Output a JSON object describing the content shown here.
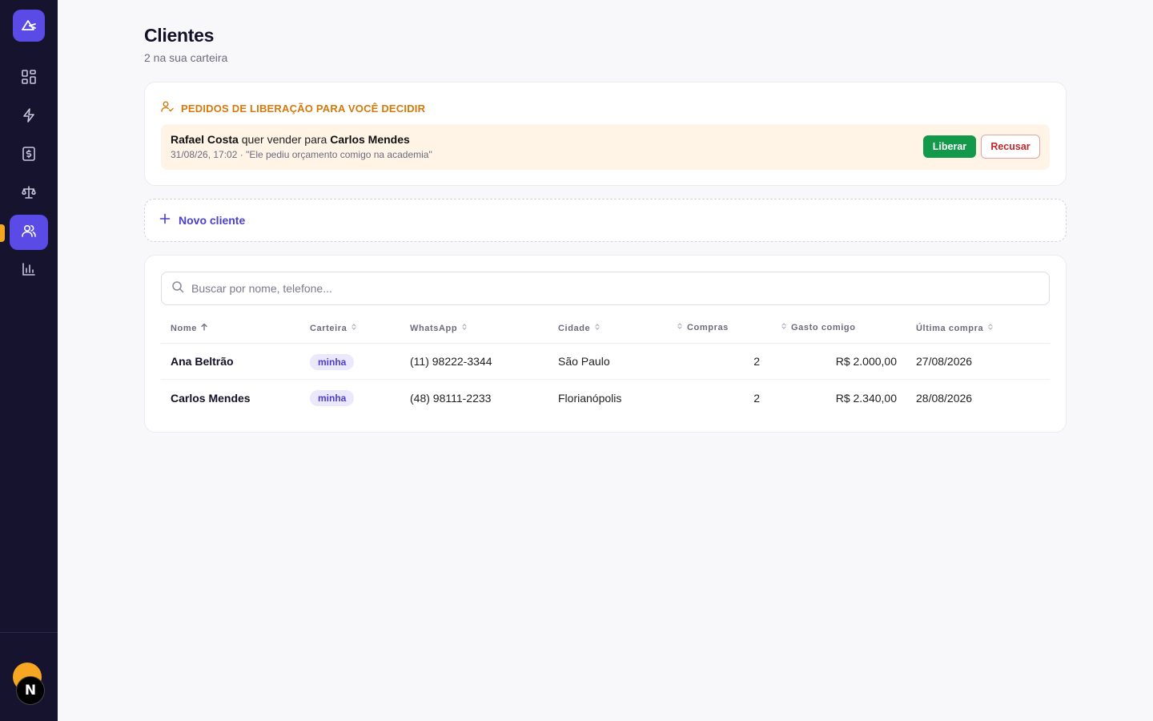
{
  "sidebar": {
    "logo": "logo-icon",
    "items": [
      {
        "icon": "dashboard-icon",
        "active": false
      },
      {
        "icon": "lightning-icon",
        "active": false
      },
      {
        "icon": "invoice-icon",
        "active": false
      },
      {
        "icon": "scale-icon",
        "active": false
      },
      {
        "icon": "users-icon",
        "active": true
      },
      {
        "icon": "bar-chart-icon",
        "active": false
      }
    ],
    "next_badge": "N"
  },
  "page": {
    "title": "Clientes",
    "subtitle": "2 na sua carteira"
  },
  "requests": {
    "title": "PEDIDOS DE LIBERAÇÃO PARA VOCÊ DECIDIR",
    "items": [
      {
        "requester": "Rafael Costa",
        "verb": " quer vender para ",
        "client": "Carlos Mendes",
        "meta": "31/08/26, 17:02 · \"Ele pediu orçamento comigo na academia\"",
        "approve_label": "Liberar",
        "reject_label": "Recusar"
      }
    ]
  },
  "new_client": {
    "label": "Novo cliente"
  },
  "search": {
    "placeholder": "Buscar por nome, telefone..."
  },
  "table": {
    "columns": [
      "Nome",
      "Carteira",
      "WhatsApp",
      "Cidade",
      "Compras",
      "Gasto comigo",
      "Última compra"
    ],
    "rows": [
      {
        "name": "Ana Beltrão",
        "wallet": "minha",
        "whatsapp": "(11) 98222-3344",
        "city": "São Paulo",
        "purchases": "2",
        "spent": "R$ 2.000,00",
        "last_purchase": "27/08/2026"
      },
      {
        "name": "Carlos Mendes",
        "wallet": "minha",
        "whatsapp": "(48) 98111-2233",
        "city": "Florianópolis",
        "purchases": "2",
        "spent": "R$ 2.340,00",
        "last_purchase": "28/08/2026"
      }
    ]
  },
  "colors": {
    "accent": "#5b4be6",
    "sidebar_bg": "#16132e",
    "warning": "#d4790b",
    "approve": "#13994a",
    "reject": "#c0282d"
  }
}
